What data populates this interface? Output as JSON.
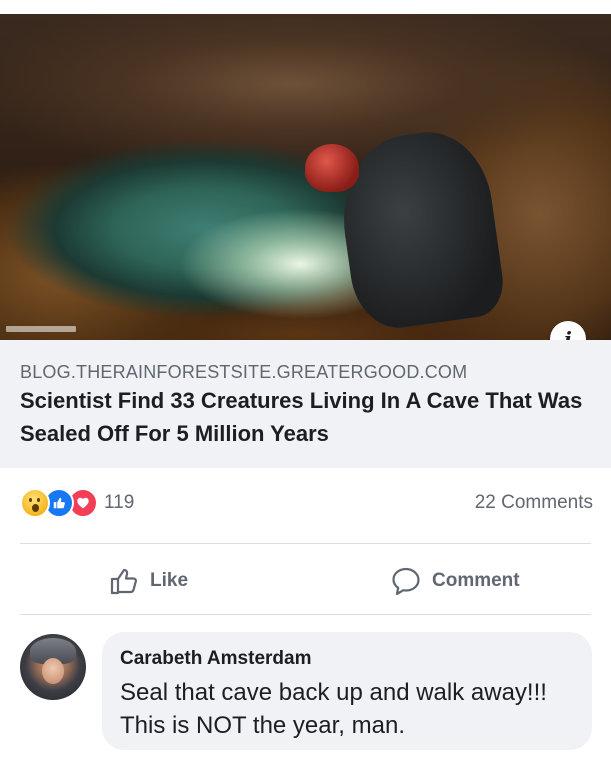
{
  "link_preview": {
    "image_alt": "Caver exploring an underground cave with a glowing green pool",
    "info_icon": "i",
    "domain": "BLOG.THERAINFORESTSITE.GREATERGOOD.COM",
    "headline": "Scientist Find 33 Creatures Living In A Cave That Was Sealed Off For 5 Million Years"
  },
  "reactions": {
    "icons": [
      "wow-icon",
      "like-icon",
      "love-icon"
    ],
    "count": "119",
    "comments_label": "22 Comments"
  },
  "actions": {
    "like_label": "Like",
    "comment_label": "Comment"
  },
  "comment": {
    "author": "Carabeth Amsterdam",
    "text": "Seal that cave back up and walk away!!! This is NOT the year, man."
  },
  "colors": {
    "link_box_bg": "#f0f2f5",
    "secondary_text": "#606770",
    "primary_text": "#1c1e21",
    "like_blue": "#1877f2",
    "love_red": "#f33e58",
    "wow_yellow": "#f5b21a"
  }
}
